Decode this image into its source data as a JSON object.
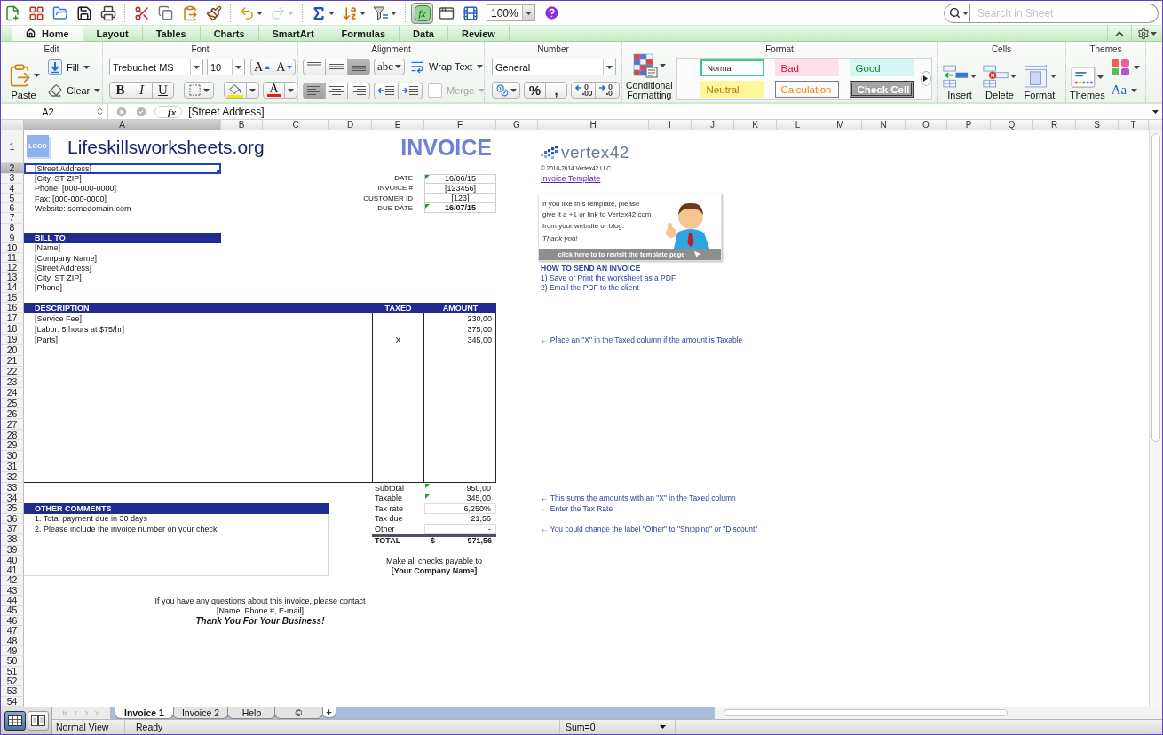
{
  "toolbar": {
    "redo_disabled": true,
    "formula_builder": {
      "label": "fx",
      "on": true
    },
    "zoom": "100%"
  },
  "search": {
    "placeholder": "Search in Sheet"
  },
  "ribbon_tabs": [
    {
      "label": "Home",
      "selected": true
    },
    {
      "label": "Layout",
      "selected": false
    },
    {
      "label": "Tables",
      "selected": false
    },
    {
      "label": "Charts",
      "selected": false
    },
    {
      "label": "SmartArt",
      "selected": false
    },
    {
      "label": "Formulas",
      "selected": false
    },
    {
      "label": "Data",
      "selected": false
    },
    {
      "label": "Review",
      "selected": false
    }
  ],
  "ribbon": {
    "edit": {
      "title": "Edit",
      "paste": "Paste",
      "fill": "Fill",
      "clear": "Clear"
    },
    "font": {
      "title": "Font",
      "name": "Trebuchet MS",
      "size": "10",
      "grow": "A",
      "shrink": "A",
      "styles": [
        {
          "label": "B",
          "kind": "bold"
        },
        {
          "label": "I",
          "kind": "italic"
        },
        {
          "label": "U",
          "kind": "underline"
        }
      ],
      "tint_label": "A"
    },
    "alignment": {
      "title": "Alignment",
      "vertical": [
        {
          "kind": "top",
          "selected": false
        },
        {
          "kind": "middle",
          "selected": false
        },
        {
          "kind": "bottom",
          "selected": true
        }
      ],
      "orientation": "abc",
      "wrap": "Wrap Text",
      "horizontal": [
        {
          "kind": "left",
          "selected": true
        },
        {
          "kind": "center",
          "selected": false
        },
        {
          "kind": "right",
          "selected": false
        }
      ],
      "merge": {
        "label": "Merge",
        "disabled": true
      }
    },
    "number": {
      "title": "Number",
      "format": "General",
      "percent": "%",
      "comma": ","
    },
    "format": {
      "title": "Format",
      "conditional": "Conditional Formatting",
      "styles": [
        {
          "label": "Normal",
          "kind": "normal",
          "selected": true
        },
        {
          "label": "Bad",
          "kind": "bad",
          "selected": false
        },
        {
          "label": "Good",
          "kind": "good",
          "selected": false
        },
        {
          "label": "Neutral",
          "kind": "neutral",
          "selected": false
        },
        {
          "label": "Calculation",
          "kind": "calculation",
          "selected": false
        },
        {
          "label": "Check Cell",
          "kind": "check",
          "selected": false
        }
      ]
    },
    "cells": {
      "title": "Cells",
      "buttons": [
        {
          "label": "Insert",
          "kind": "insert"
        },
        {
          "label": "Delete",
          "kind": "delete"
        },
        {
          "label": "Format",
          "kind": "format"
        }
      ]
    },
    "themes": {
      "title": "Themes",
      "themes": "Themes",
      "fonts": "Aa"
    }
  },
  "formula_bar": {
    "cell": "A2",
    "fx": "fx",
    "value": "[Street Address]"
  },
  "columns": [
    {
      "label": "A",
      "selected": true
    },
    {
      "label": "B",
      "selected": false
    },
    {
      "label": "C",
      "selected": false
    },
    {
      "label": "D",
      "selected": false
    },
    {
      "label": "E",
      "selected": false
    },
    {
      "label": "F",
      "selected": false
    },
    {
      "label": "G",
      "selected": false
    },
    {
      "label": "H",
      "selected": false
    },
    {
      "label": "I",
      "selected": false
    },
    {
      "label": "J",
      "selected": false
    },
    {
      "label": "K",
      "selected": false
    },
    {
      "label": "L",
      "selected": false
    },
    {
      "label": "M",
      "selected": false
    },
    {
      "label": "N",
      "selected": false
    },
    {
      "label": "O",
      "selected": false
    },
    {
      "label": "P",
      "selected": false
    },
    {
      "label": "Q",
      "selected": false
    },
    {
      "label": "R",
      "selected": false
    },
    {
      "label": "S",
      "selected": false
    },
    {
      "label": "T",
      "selected": false
    }
  ],
  "rows": [
    {
      "label": "1",
      "selected": false
    },
    {
      "label": "2",
      "selected": true
    },
    {
      "label": "3",
      "selected": false
    },
    {
      "label": "4",
      "selected": false
    },
    {
      "label": "5",
      "selected": false
    },
    {
      "label": "6",
      "selected": false
    },
    {
      "label": "7",
      "selected": false
    },
    {
      "label": "8",
      "selected": false
    },
    {
      "label": "9",
      "selected": false
    },
    {
      "label": "10",
      "selected": false
    },
    {
      "label": "11",
      "selected": false
    },
    {
      "label": "12",
      "selected": false
    },
    {
      "label": "13",
      "selected": false
    },
    {
      "label": "14",
      "selected": false
    },
    {
      "label": "15",
      "selected": false
    },
    {
      "label": "16",
      "selected": false
    },
    {
      "label": "17",
      "selected": false
    },
    {
      "label": "18",
      "selected": false
    },
    {
      "label": "19",
      "selected": false
    },
    {
      "label": "20",
      "selected": false
    },
    {
      "label": "21",
      "selected": false
    },
    {
      "label": "22",
      "selected": false
    },
    {
      "label": "23",
      "selected": false
    },
    {
      "label": "24",
      "selected": false
    },
    {
      "label": "25",
      "selected": false
    },
    {
      "label": "26",
      "selected": false
    },
    {
      "label": "27",
      "selected": false
    },
    {
      "label": "28",
      "selected": false
    },
    {
      "label": "29",
      "selected": false
    },
    {
      "label": "30",
      "selected": false
    },
    {
      "label": "31",
      "selected": false
    },
    {
      "label": "32",
      "selected": false
    },
    {
      "label": "33",
      "selected": false
    },
    {
      "label": "34",
      "selected": false
    },
    {
      "label": "35",
      "selected": false
    },
    {
      "label": "36",
      "selected": false
    },
    {
      "label": "37",
      "selected": false
    },
    {
      "label": "38",
      "selected": false
    },
    {
      "label": "39",
      "selected": false
    },
    {
      "label": "40",
      "selected": false
    },
    {
      "label": "41",
      "selected": false
    },
    {
      "label": "42",
      "selected": false
    },
    {
      "label": "43",
      "selected": false
    },
    {
      "label": "44",
      "selected": false
    },
    {
      "label": "45",
      "selected": false
    },
    {
      "label": "46",
      "selected": false
    },
    {
      "label": "47",
      "selected": false
    },
    {
      "label": "48",
      "selected": false
    },
    {
      "label": "49",
      "selected": false
    },
    {
      "label": "50",
      "selected": false
    },
    {
      "label": "51",
      "selected": false
    },
    {
      "label": "52",
      "selected": false
    },
    {
      "label": "53",
      "selected": false
    },
    {
      "label": "54",
      "selected": false
    }
  ],
  "invoice": {
    "logo": "LOGO",
    "company": "Lifeskillsworksheets.org",
    "title": "INVOICE",
    "address": [
      {
        "text": "[Street Address]",
        "selected": true
      },
      {
        "text": "[City, ST  ZIP]",
        "selected": false
      },
      {
        "text": "Phone: [000-000-0000]",
        "selected": false
      },
      {
        "text": "Fax: [000-000-0000]",
        "selected": false
      },
      {
        "text": "Website: somedomain.com",
        "selected": false
      }
    ],
    "meta": [
      {
        "label": "DATE",
        "value": "16/06/15",
        "flagged": true,
        "bold": false
      },
      {
        "label": "INVOICE #",
        "value": "[123456]",
        "flagged": false,
        "bold": false
      },
      {
        "label": "CUSTOMER ID",
        "value": "[123]",
        "flagged": false,
        "bold": false
      },
      {
        "label": "DUE DATE",
        "value": "16/07/15",
        "flagged": true,
        "bold": true
      }
    ],
    "bill_to": {
      "title": "BILL TO",
      "lines": [
        "[Name]",
        "[Company Name]",
        "[Street Address]",
        "[City, ST  ZIP]",
        "[Phone]"
      ]
    },
    "items": {
      "columns": [
        "DESCRIPTION",
        "TAXED",
        "AMOUNT"
      ],
      "rows": [
        {
          "description": "[Service Fee]",
          "amount": "230,00"
        },
        {
          "description": "[Labor: 5 hours at $75/hr]",
          "amount": "375,00"
        },
        {
          "description": "[Parts]",
          "taxed": "X",
          "amount": "345,00",
          "note": "← Place an \"X\" in the Taxed column if the amount is Taxable"
        }
      ]
    },
    "totals": [
      {
        "label": "Subtotal",
        "value": "950,00",
        "flagged": true,
        "boxed": false
      },
      {
        "label": "Taxable",
        "value": "345,00",
        "flagged": true,
        "boxed": false,
        "note": "← This sums the amounts with an \"X\" in the Taxed column"
      },
      {
        "label": "Tax rate",
        "value": "6,250%",
        "flagged": false,
        "boxed": true,
        "note": "← Enter the Tax Rate"
      },
      {
        "label": "Tax due",
        "value": "21,56",
        "flagged": false,
        "boxed": false
      },
      {
        "label": "Other",
        "value": "-",
        "flagged": false,
        "boxed": true,
        "note": "← You could change the label \"Other\" to \"Shipping\" or \"Discount\""
      }
    ],
    "total": {
      "label": "TOTAL",
      "currency": "$",
      "value": "971,56"
    },
    "comments": {
      "title": "OTHER COMMENTS",
      "lines": [
        "1. Total payment due in 30 days",
        "2. Please include the invoice number on your check"
      ]
    },
    "payable": {
      "text": "Make all checks payable to",
      "name": "[Your Company Name]"
    },
    "contact": {
      "lines": [
        "If you have any questions about this invoice, please contact",
        "[Name, Phone #, E-mail]"
      ],
      "thanks": "Thank You For Your Business!"
    }
  },
  "side": {
    "logo": "vertex42",
    "copyright": "© 2010-2014 Vertex42 LLC",
    "link": "Invoice Template",
    "promo": {
      "lines": [
        "If you like this template, please",
        "give it a +1 or link to Vertex42.com",
        "from your website or blog."
      ],
      "thanks": "Thank you!",
      "banner": "click here to to revisit the template page"
    },
    "howto": {
      "title": "HOW TO SEND AN INVOICE",
      "steps": [
        "1) Save or Print the worksheet as a PDF",
        "2) Email the PDF to the client"
      ]
    }
  },
  "views": [
    {
      "kind": "normal",
      "selected": true
    },
    {
      "kind": "page_layout",
      "selected": false
    }
  ],
  "sheet_tabs": [
    {
      "label": "Invoice 1",
      "selected": true
    },
    {
      "label": "Invoice 2",
      "selected": false
    },
    {
      "label": "Help",
      "selected": false
    },
    {
      "label": "©",
      "selected": false
    }
  ],
  "add_sheet": "+",
  "status_bar": {
    "view": "Normal View",
    "state": "Ready",
    "sum": "Sum=0"
  }
}
